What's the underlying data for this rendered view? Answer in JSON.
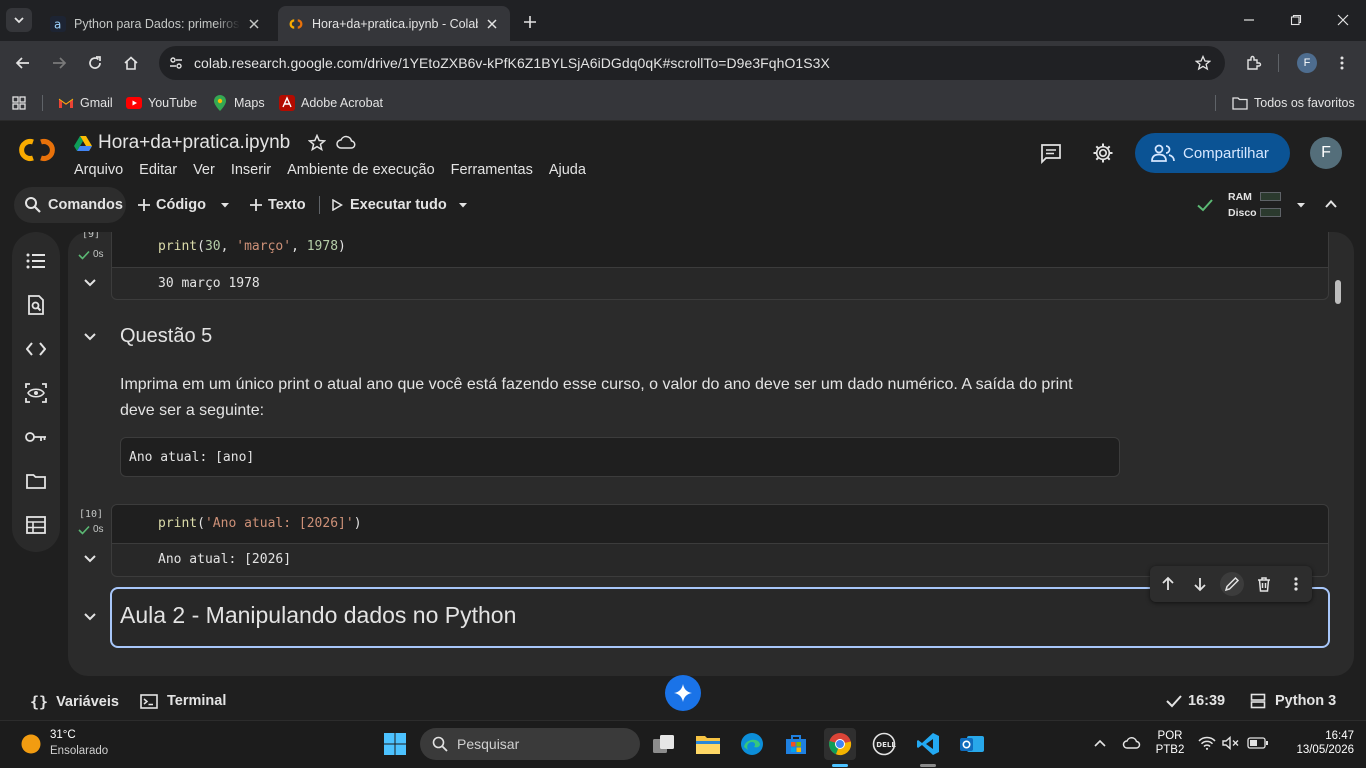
{
  "browser": {
    "tabs": [
      {
        "label": "Python para Dados: primeiros p",
        "favicon": "alura-icon",
        "active": false
      },
      {
        "label": "Hora+da+pratica.ipynb - Colab",
        "favicon": "colab-icon",
        "active": true
      }
    ],
    "url": "colab.research.google.com/drive/1YEtoZXB6v-kPfK6Z1BYLSjA6iDGdq0qK#scrollTo=D9e3FqhO1S3X",
    "profile_initial": "F",
    "bookmarks": [
      {
        "label": "Gmail",
        "icon": "gmail-icon"
      },
      {
        "label": "YouTube",
        "icon": "youtube-icon"
      },
      {
        "label": "Maps",
        "icon": "maps-icon"
      },
      {
        "label": "Adobe Acrobat",
        "icon": "acrobat-icon"
      }
    ],
    "all_bookmarks_label": "Todos os favoritos"
  },
  "colab": {
    "notebook_title": "Hora+da+pratica.ipynb",
    "menu": [
      "Arquivo",
      "Editar",
      "Ver",
      "Inserir",
      "Ambiente de execução",
      "Ferramentas",
      "Ajuda"
    ],
    "share_label": "Compartilhar",
    "user_initial": "F",
    "toolbar": {
      "commands_label": "Comandos",
      "code_label": "Código",
      "text_label": "Texto",
      "run_all_label": "Executar tudo",
      "ram_label": "RAM",
      "disk_label": "Disco"
    },
    "accent_color": "#0b5394"
  },
  "notebook": {
    "cell_prev": {
      "exec_count": "[9]",
      "time": "0s",
      "code": {
        "fn": "print",
        "args_open": "(",
        "num1": "30",
        "sep1": ", ",
        "str1": "'março'",
        "sep2": ", ",
        "num2": "1978",
        "close": ")"
      },
      "output": "30 março 1978"
    },
    "section_heading": "Questão 5",
    "instructions": "Imprima em um único print o atual ano que você está fazendo esse curso, o valor do ano deve ser um dado numérico. A saída do print deve ser a seguinte:",
    "example_output": "Ano atual: [ano]",
    "cell_answer": {
      "exec_count": "[10]",
      "time": "0s",
      "code": {
        "fn": "print",
        "open": "(",
        "str": "'Ano atual: [2026]'",
        "close": ")"
      },
      "output": "Ano atual: [2026]"
    },
    "selected_heading": "Aula 2 - Manipulando dados no Python"
  },
  "statusbar": {
    "variables_label": "Variáveis",
    "terminal_label": "Terminal",
    "time": "16:39",
    "runtime": "Python 3"
  },
  "taskbar": {
    "weather_temp": "31°C",
    "weather_desc": "Ensolarado",
    "search_placeholder": "Pesquisar",
    "lang_top": "POR",
    "lang_bottom": "PTB2",
    "clock_time": "16:47",
    "clock_date": "13/05/2026"
  }
}
